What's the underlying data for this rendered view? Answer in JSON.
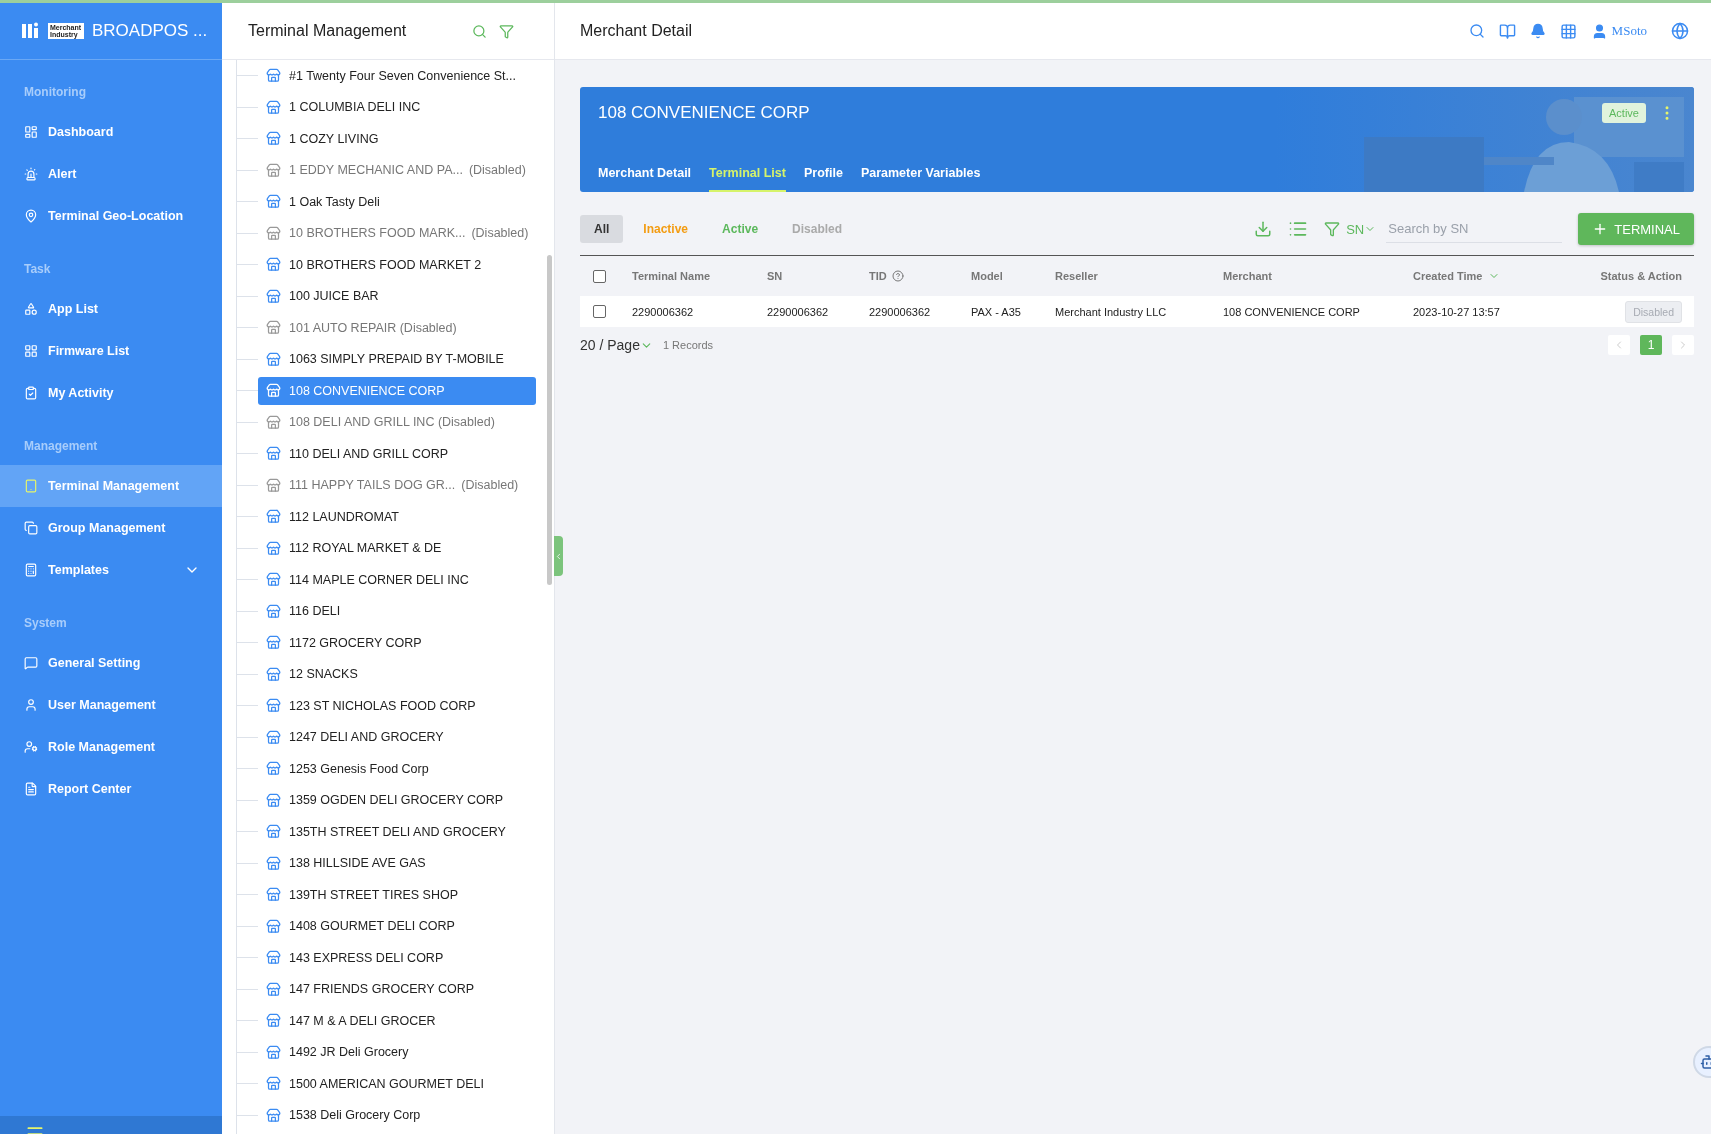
{
  "app": {
    "logo_text": "Merchant Industry",
    "title": "BROADPOS ..."
  },
  "sidebar": {
    "sections": [
      {
        "label": "Monitoring",
        "items": [
          {
            "label": "Dashboard",
            "selected": false
          },
          {
            "label": "Alert",
            "selected": false
          },
          {
            "label": "Terminal Geo-Location",
            "selected": false
          }
        ]
      },
      {
        "label": "Task",
        "items": [
          {
            "label": "App List",
            "selected": false
          },
          {
            "label": "Firmware List",
            "selected": false
          },
          {
            "label": "My Activity",
            "selected": false
          }
        ]
      },
      {
        "label": "Management",
        "items": [
          {
            "label": "Terminal Management",
            "selected": true
          },
          {
            "label": "Group Management",
            "selected": false
          },
          {
            "label": "Templates",
            "selected": false,
            "expanded": false
          }
        ]
      },
      {
        "label": "System",
        "items": [
          {
            "label": "General Setting",
            "selected": false
          },
          {
            "label": "User Management",
            "selected": false
          },
          {
            "label": "Role Management",
            "selected": false
          },
          {
            "label": "Report Center",
            "selected": false
          }
        ]
      }
    ]
  },
  "tree_panel": {
    "title": "Terminal Management",
    "items": [
      {
        "label": "#1 Twenty Four Seven Convenience St...",
        "disabled": false,
        "selected": false
      },
      {
        "label": "1 COLUMBIA DELI INC",
        "disabled": false,
        "selected": false
      },
      {
        "label": "1 COZY LIVING",
        "disabled": false,
        "selected": false
      },
      {
        "label": "1 EDDY MECHANIC AND PA...",
        "note": "(Disabled)",
        "disabled": true,
        "selected": false
      },
      {
        "label": "1 Oak Tasty Deli",
        "disabled": false,
        "selected": false
      },
      {
        "label": "10 BROTHERS FOOD MARK...",
        "note": "(Disabled)",
        "disabled": true,
        "selected": false
      },
      {
        "label": "10 BROTHERS FOOD MARKET 2",
        "disabled": false,
        "selected": false
      },
      {
        "label": "100 JUICE BAR",
        "disabled": false,
        "selected": false
      },
      {
        "label": "101 AUTO REPAIR (Disabled)",
        "disabled": true,
        "selected": false
      },
      {
        "label": "1063 SIMPLY PREPAID BY T-MOBILE",
        "disabled": false,
        "selected": false
      },
      {
        "label": "108 CONVENIENCE CORP",
        "disabled": false,
        "selected": true
      },
      {
        "label": "108 DELI AND GRILL INC (Disabled)",
        "disabled": true,
        "selected": false
      },
      {
        "label": "110 DELI AND GRILL CORP",
        "disabled": false,
        "selected": false
      },
      {
        "label": "111 HAPPY TAILS DOG GR...",
        "note": "(Disabled)",
        "disabled": true,
        "selected": false
      },
      {
        "label": "112 LAUNDROMAT",
        "disabled": false,
        "selected": false
      },
      {
        "label": "112 ROYAL MARKET & DE",
        "disabled": false,
        "selected": false
      },
      {
        "label": "114 MAPLE CORNER DELI INC",
        "disabled": false,
        "selected": false
      },
      {
        "label": "116 DELI",
        "disabled": false,
        "selected": false
      },
      {
        "label": "1172 GROCERY CORP",
        "disabled": false,
        "selected": false
      },
      {
        "label": "12 SNACKS",
        "disabled": false,
        "selected": false
      },
      {
        "label": "123 ST NICHOLAS FOOD CORP",
        "disabled": false,
        "selected": false
      },
      {
        "label": "1247 DELI AND  GROCERY",
        "disabled": false,
        "selected": false
      },
      {
        "label": "1253 Genesis Food Corp",
        "disabled": false,
        "selected": false
      },
      {
        "label": "1359 OGDEN DELI GROCERY CORP",
        "disabled": false,
        "selected": false
      },
      {
        "label": "135TH STREET DELI AND  GROCERY",
        "disabled": false,
        "selected": false
      },
      {
        "label": "138 HILLSIDE AVE GAS",
        "disabled": false,
        "selected": false
      },
      {
        "label": "139TH STREET TIRES SHOP",
        "disabled": false,
        "selected": false
      },
      {
        "label": "1408 GOURMET DELI CORP",
        "disabled": false,
        "selected": false
      },
      {
        "label": "143 EXPRESS DELI CORP",
        "disabled": false,
        "selected": false
      },
      {
        "label": "147 FRIENDS GROCERY CORP",
        "disabled": false,
        "selected": false
      },
      {
        "label": "147 M & A DELI GROCER",
        "disabled": false,
        "selected": false
      },
      {
        "label": "1492 JR Deli Grocery",
        "disabled": false,
        "selected": false
      },
      {
        "label": "1500 AMERICAN GOURMET DELI",
        "disabled": false,
        "selected": false
      },
      {
        "label": "1538 Deli Grocery Corp",
        "disabled": false,
        "selected": false
      }
    ]
  },
  "header": {
    "title": "Merchant Detail",
    "user": "MSoto"
  },
  "merchant_card": {
    "name": "108 CONVENIENCE CORP",
    "status": "Active",
    "tabs": [
      {
        "label": "Merchant Detail",
        "selected": false
      },
      {
        "label": "Terminal List",
        "selected": true
      },
      {
        "label": "Profile",
        "selected": false
      },
      {
        "label": "Parameter Variables",
        "selected": false
      }
    ]
  },
  "filters": [
    {
      "label": "All",
      "selected": true,
      "color": "#333333"
    },
    {
      "label": "Inactive",
      "selected": false,
      "color": "#f39c12"
    },
    {
      "label": "Active",
      "selected": false,
      "color": "#5cb85c"
    },
    {
      "label": "Disabled",
      "selected": false,
      "color": "#aaaaaa"
    }
  ],
  "search": {
    "field": "SN",
    "placeholder": "Search by SN"
  },
  "add_button": "TERMINAL",
  "table": {
    "select_all_checked": false,
    "columns": [
      "Terminal Name",
      "SN",
      "TID",
      "Model",
      "Reseller",
      "Merchant",
      "Created Time",
      "Status & Action"
    ],
    "rows": [
      {
        "checked": false,
        "cells": [
          "2290006362",
          "2290006362",
          "2290006362",
          "PAX - A35",
          "Merchant Industry LLC",
          "108 CONVENIENCE CORP",
          "2023-10-27 13:57"
        ],
        "status": "Disabled"
      }
    ]
  },
  "pagination": {
    "page_size": "20 / Page",
    "records": "1 Records",
    "pages": [
      {
        "label": "1",
        "selected": true
      }
    ]
  }
}
